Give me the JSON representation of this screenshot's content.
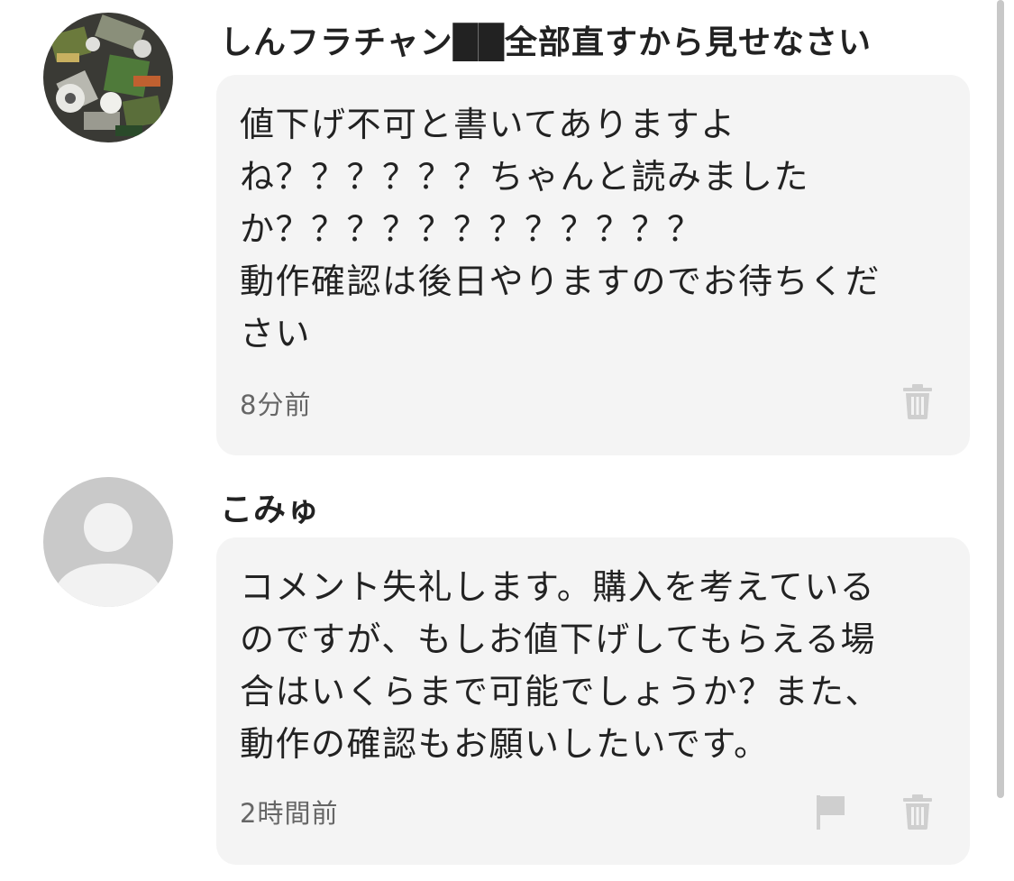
{
  "comments": [
    {
      "username": "しんフラチャン██全部直すから見せなさい",
      "body": "値下げ不可と書いてありますよ\nね？？？？？？ちゃんと読みました\nか？？？？？？？？？？？？\n動作確認は後日やりますのでお待ちくだ\nさい",
      "timestamp": "8分前",
      "avatar": "photo-avatar",
      "actions": [
        "trash-icon"
      ]
    },
    {
      "username": "こみゅ",
      "body": "コメント失礼します。購入を考えている\nのですが、もしお値下げしてもらえる場\n合はいくらまで可能でしょうか？また、\n動作の確認もお願いしたいです。",
      "timestamp": "2時間前",
      "avatar": "default-user-avatar",
      "actions": [
        "flag-icon",
        "trash-icon"
      ]
    }
  ],
  "colors": {
    "bubble": "#f4f4f4",
    "icon": "#cfcfcf",
    "text": "#222222",
    "timestamp": "#666666"
  }
}
